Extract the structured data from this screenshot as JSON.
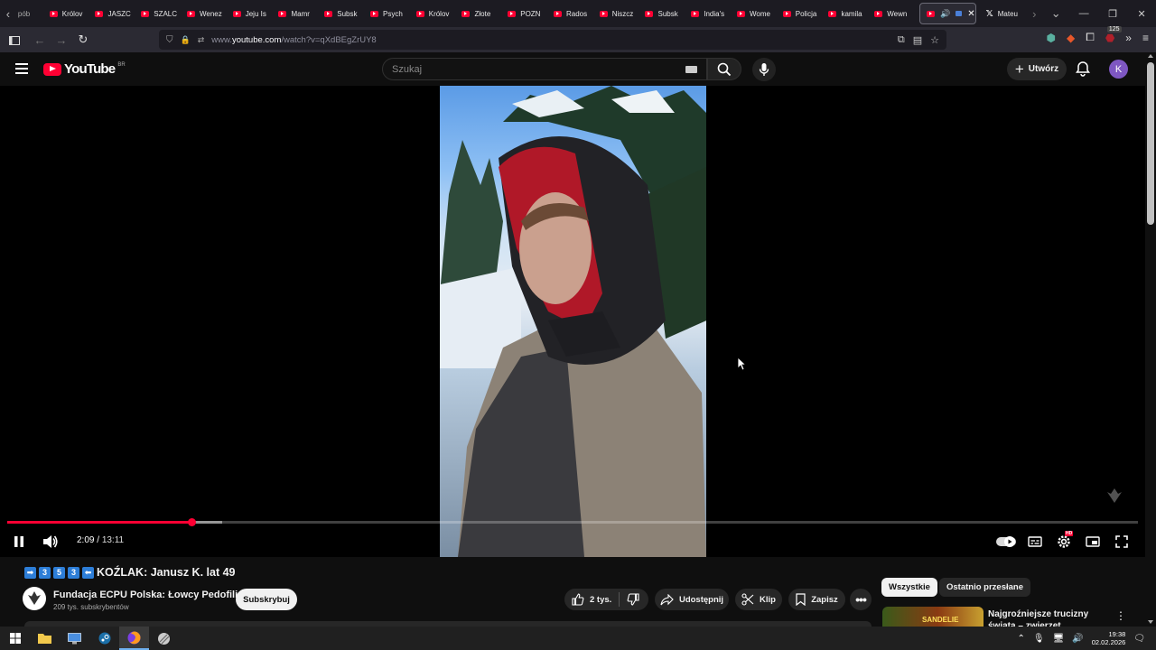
{
  "browser": {
    "tabs": [
      {
        "label": "pób"
      },
      {
        "label": "Królov"
      },
      {
        "label": "JASZC"
      },
      {
        "label": "SZALC"
      },
      {
        "label": "Wenez"
      },
      {
        "label": "Jeju Is"
      },
      {
        "label": "Mamr"
      },
      {
        "label": "Subsk"
      },
      {
        "label": "Psych"
      },
      {
        "label": "Królov"
      },
      {
        "label": "Złote"
      },
      {
        "label": "POZN"
      },
      {
        "label": "Rados"
      },
      {
        "label": "Niszcz"
      },
      {
        "label": "Subsk"
      },
      {
        "label": "India's"
      },
      {
        "label": "Wome"
      },
      {
        "label": "Policja"
      },
      {
        "label": "kamila"
      },
      {
        "label": "Wewn"
      }
    ],
    "x_tab_label": "Mateu",
    "url_prefix": "www.",
    "url_domain": "youtube.com",
    "url_path": "/watch?v=qXdBEgZrUY8",
    "extension_badge": "125"
  },
  "youtube": {
    "logo_text": "YouTube",
    "country_code": "BR",
    "search_placeholder": "Szukaj",
    "create_label": "Utwórz",
    "avatar_letter": "K"
  },
  "player": {
    "current_time": "2:09",
    "duration": "13:11",
    "time_separator": "/",
    "played_fraction": 0.163,
    "buffered_fraction": 0.19,
    "settings_badge": "HD"
  },
  "video": {
    "title_badges": [
      "➡",
      "3",
      "5",
      "3",
      "⬅"
    ],
    "title_text": "KOŹLAK: Janusz K. lat 49",
    "channel_name": "Fundacja ECPU Polska: Łowcy Pedofili",
    "subscribers": "209 tys. subskrybentów",
    "subscribe_label": "Subskrybuj",
    "like_count": "2 tys.",
    "share_label": "Udostępnij",
    "clip_label": "Klip",
    "save_label": "Zapisz"
  },
  "sidebar": {
    "chips": [
      "Wszystkie",
      "Ostatnio przesłane"
    ],
    "recommendation_title": "Najgroźniejsze trucizny świata – zwierzęt",
    "thumb_text": "SANDELIE"
  },
  "taskbar": {
    "time": "19:38",
    "date": "02.02.2026"
  }
}
